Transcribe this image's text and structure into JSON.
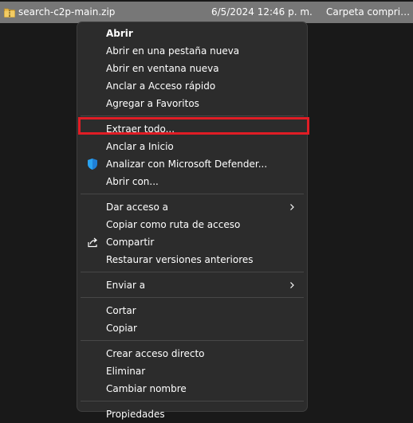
{
  "file": {
    "name": "search-c2p-main.zip",
    "date": "6/5/2024 12:46 p. m.",
    "type": "Carpeta comprimida (en zip)",
    "icon": "zip-folder-icon"
  },
  "menu": {
    "groups": [
      {
        "items": [
          {
            "label": "Abrir",
            "bold": true
          },
          {
            "label": "Abrir en una pestaña nueva"
          },
          {
            "label": "Abrir en ventana nueva"
          },
          {
            "label": "Anclar a Acceso rápido"
          },
          {
            "label": "Agregar a Favoritos"
          }
        ]
      },
      {
        "items": [
          {
            "label": "Extraer todo..."
          },
          {
            "label": "Anclar a Inicio"
          },
          {
            "label": "Analizar con Microsoft Defender...",
            "icon": "defender-shield-icon"
          },
          {
            "label": "Abrir con..."
          }
        ]
      },
      {
        "items": [
          {
            "label": "Dar acceso a",
            "submenu": true
          },
          {
            "label": "Copiar como ruta de acceso"
          },
          {
            "label": "Compartir",
            "icon": "share-icon"
          },
          {
            "label": "Restaurar versiones anteriores"
          }
        ]
      },
      {
        "items": [
          {
            "label": "Enviar a",
            "submenu": true
          }
        ]
      },
      {
        "items": [
          {
            "label": "Cortar"
          },
          {
            "label": "Copiar"
          }
        ]
      },
      {
        "items": [
          {
            "label": "Crear acceso directo"
          },
          {
            "label": "Eliminar"
          },
          {
            "label": "Cambiar nombre"
          }
        ]
      },
      {
        "items": [
          {
            "label": "Propiedades"
          }
        ]
      }
    ]
  },
  "highlight": {
    "target": "Extraer todo...",
    "color": "#e01d25"
  },
  "colors": {
    "menu_bg": "#2c2c2c",
    "row_selected_bg": "#777777",
    "text": "#ffffff",
    "defender_blue": "#1f7fd6"
  }
}
